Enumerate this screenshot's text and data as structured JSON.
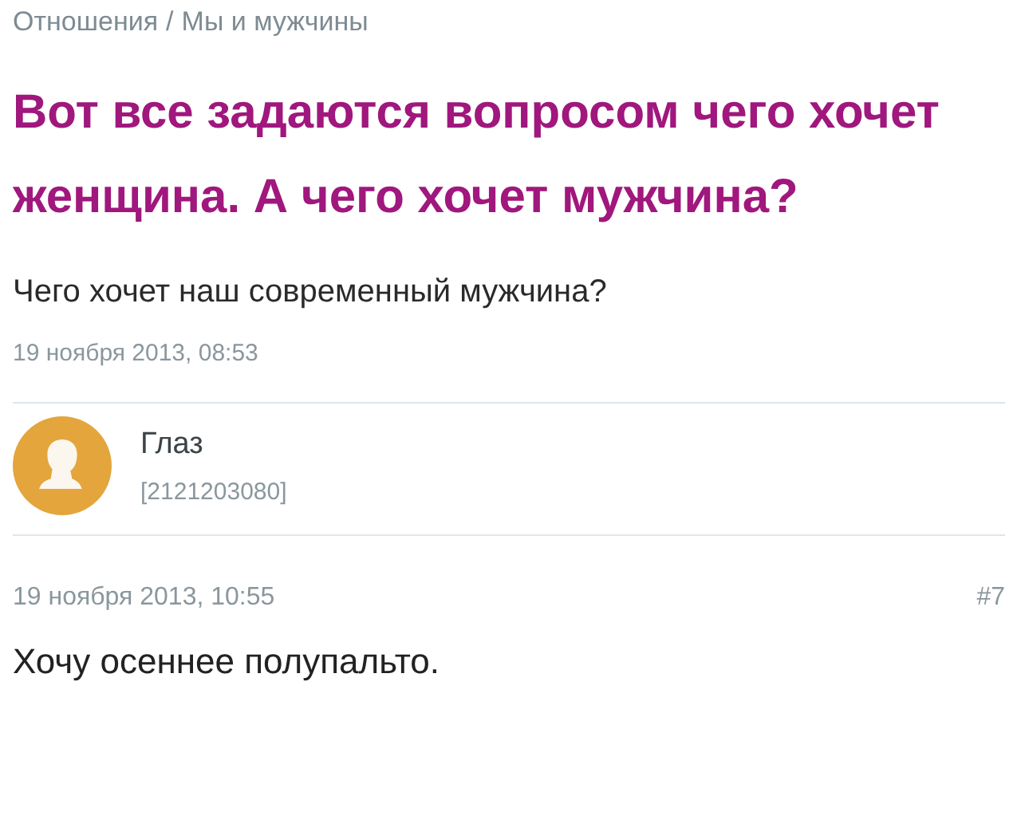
{
  "breadcrumbs": [
    "Отношения",
    "Мы и мужчины"
  ],
  "breadcrumb_separator": "/",
  "topic": {
    "title": "Вот все задаются вопросом чего хочет женщина. А чего хочет мужчина?",
    "text": "Чего хочет наш современный мужчина?",
    "date": "19 ноября 2013, 08:53"
  },
  "post": {
    "author": "Глаз",
    "author_id": "[2121203080]",
    "date": "19 ноября 2013, 10:55",
    "number": "#7",
    "text": "Хочу осеннее полупальто."
  }
}
